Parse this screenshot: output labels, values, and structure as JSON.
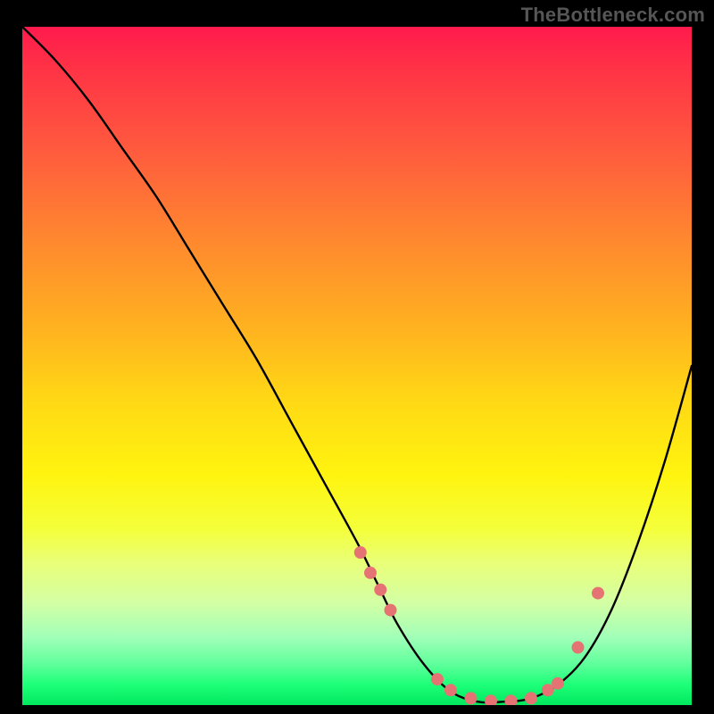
{
  "watermark": "TheBottleneck.com",
  "chart_data": {
    "type": "line",
    "title": "",
    "xlabel": "",
    "ylabel": "",
    "xlim": [
      0,
      100
    ],
    "ylim": [
      0,
      100
    ],
    "grid": false,
    "legend": false,
    "gradient_stops": [
      {
        "pos": 0,
        "color": "#ff1a4d"
      },
      {
        "pos": 18,
        "color": "#ff5a3e"
      },
      {
        "pos": 45,
        "color": "#ffb41f"
      },
      {
        "pos": 66,
        "color": "#fff40f"
      },
      {
        "pos": 85,
        "color": "#d3ffa5"
      },
      {
        "pos": 100,
        "color": "#00e85e"
      }
    ],
    "series": [
      {
        "name": "bottleneck-curve",
        "x": [
          0,
          5,
          10,
          15,
          20,
          25,
          30,
          35,
          40,
          45,
          50,
          53,
          56,
          60,
          64,
          68,
          72,
          76,
          80,
          84,
          88,
          92,
          96,
          100
        ],
        "y": [
          100,
          95,
          89,
          82,
          75,
          67,
          59,
          51,
          42,
          33,
          24,
          18,
          12,
          6,
          2,
          0.5,
          0.5,
          1,
          3,
          7,
          14,
          24,
          36,
          50
        ]
      }
    ],
    "markers": {
      "name": "highlight-points",
      "color": "#e57373",
      "x": [
        50.5,
        52.0,
        53.5,
        55.0,
        62.0,
        64.0,
        67.0,
        70.0,
        73.0,
        76.0,
        78.5,
        80.0,
        83.0,
        86.0
      ],
      "y": [
        22.5,
        19.5,
        17.0,
        14.0,
        3.8,
        2.2,
        1.0,
        0.6,
        0.6,
        1.0,
        2.2,
        3.2,
        8.5,
        16.5
      ]
    }
  }
}
